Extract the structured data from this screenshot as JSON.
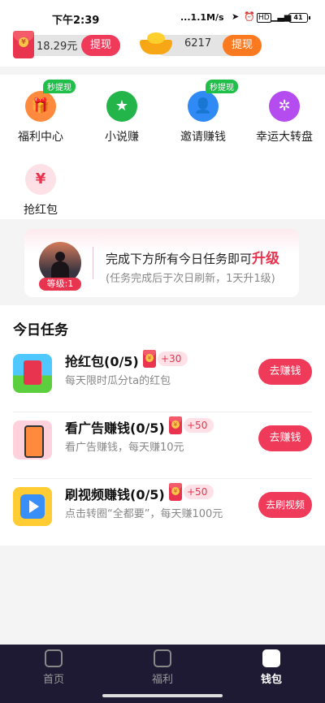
{
  "status_bar": {
    "time": "下午2:39",
    "network": "...1.1M/s",
    "battery": "41"
  },
  "balance": {
    "cash_value": "18.29元",
    "cash_withdraw_label": "提现",
    "coins_value": "6217",
    "coins_withdraw_label": "提现"
  },
  "features": [
    {
      "label": "福利中心",
      "badge": "秒提现",
      "icon": "gift-icon"
    },
    {
      "label": "小说赚",
      "badge": "",
      "icon": "book-icon"
    },
    {
      "label": "邀请赚钱",
      "badge": "秒提现",
      "icon": "invite-user-icon"
    },
    {
      "label": "幸运大转盘",
      "badge": "",
      "icon": "wheel-icon"
    },
    {
      "label": "抢红包",
      "badge": "",
      "icon": "red-envelope-icon"
    }
  ],
  "level_card": {
    "level_badge": "等级:1",
    "line1_prefix": "完成下方所有今日任务即可",
    "line1_highlight": "升级",
    "line2": "(任务完成后于次日刷新，1天升1级)"
  },
  "tasks": {
    "heading": "今日任务",
    "items": [
      {
        "title": "抢红包(0/5)",
        "reward": "+30",
        "subtitle": "每天限时瓜分ta的红包",
        "action": "去赚钱"
      },
      {
        "title": "看广告赚钱(0/5)",
        "reward": "+50",
        "subtitle": "看广告赚钱，每天赚10元",
        "action": "去赚钱"
      },
      {
        "title": "刷视频赚钱(0/5)",
        "reward": "+50",
        "subtitle": "点击转圈“全都要”，每天赚100元",
        "action": "去刷视频"
      }
    ]
  },
  "bottom_nav": [
    {
      "label": "首页",
      "active": false
    },
    {
      "label": "福利",
      "active": false
    },
    {
      "label": "钱包",
      "active": true
    }
  ],
  "colors": {
    "accent_red": "#f03a5a",
    "accent_orange": "#fb7a20",
    "nav_bg": "#1e1a33",
    "badge_green": "#1fbf4a"
  }
}
